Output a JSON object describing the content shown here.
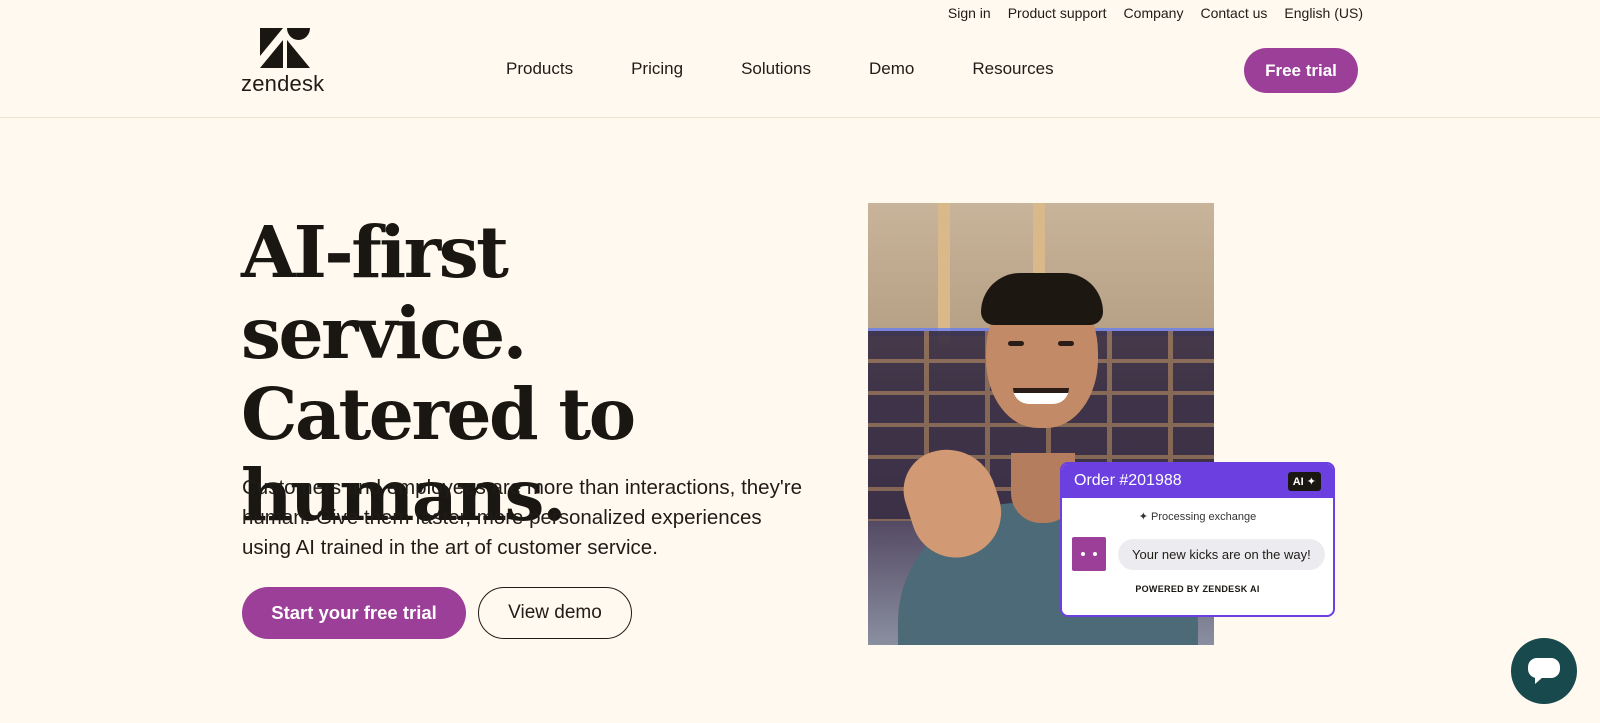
{
  "utility_nav": [
    "Sign in",
    "Product support",
    "Company",
    "Contact us",
    "English (US)"
  ],
  "brand": {
    "name": "zendesk",
    "accent_color": "#9c3f98"
  },
  "main_nav": [
    "Products",
    "Pricing",
    "Solutions",
    "Demo",
    "Resources"
  ],
  "header_cta": "Free trial",
  "hero": {
    "headline_lines": [
      "AI-first service.",
      "Catered to",
      "humans."
    ],
    "subtext": "Customers and employees are more than interactions, they're human. Give them faster, more personalized experiences using AI trained in the art of customer service.",
    "primary_cta": "Start your free trial",
    "secondary_cta": "View demo"
  },
  "order_card": {
    "title": "Order #201988",
    "ai_badge": "AI ✦",
    "status": "Processing exchange",
    "message": "Your new kicks are on the way!",
    "footer": "POWERED BY ZENDESK AI",
    "accent_color": "#6b3fe0"
  },
  "chat_widget": {
    "icon": "chat-bubble-icon",
    "color": "#17494d"
  }
}
